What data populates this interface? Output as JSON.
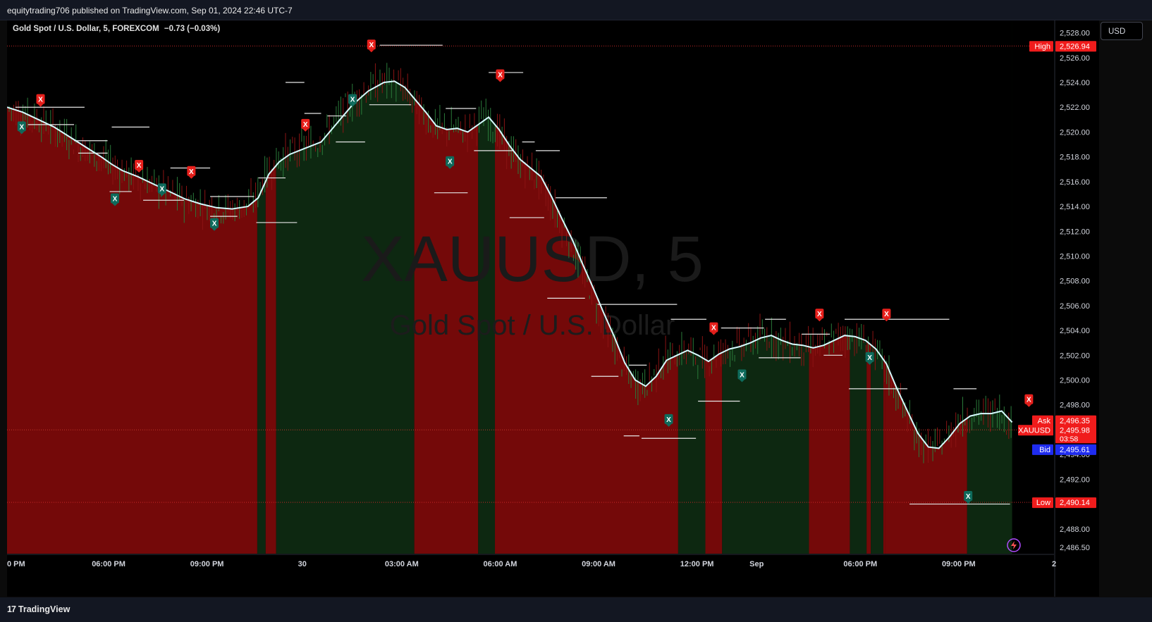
{
  "header": {
    "publish_line": "equitytrading706 published on TradingView.com, Sep 01, 2024 22:46 UTC-7"
  },
  "symbol_line": {
    "text": "Gold Spot / U.S. Dollar, 5, FOREXCOM",
    "change": "−0.73 (−0.03%)"
  },
  "currency_button": "USD",
  "footer": {
    "brand": "TradingView",
    "brand_mark": "17"
  },
  "colors": {
    "background": "#000000",
    "bear_fill": "#7a0a0a",
    "bull_fill": "#0e2a12",
    "candle_up": "#26a69a",
    "candle_down": "#ef5350",
    "ema_line": "#d6fbff",
    "x_buy_marker": "#0e6b5c",
    "x_sell_marker": "#e8201c",
    "grid": "#141414",
    "price_tag_red": "#f01c1c",
    "price_tag_blue": "#1f2cf0"
  },
  "chart_data": {
    "type": "line",
    "title": "Gold Spot / U.S. Dollar, 5, FOREXCOM",
    "watermark": {
      "symbol": "XAUUSD, 5",
      "name": "Gold Spot / U.S. Dollar"
    },
    "xlabel": "",
    "ylabel": "",
    "ylim": [
      2486.0,
      2529.0
    ],
    "y_ticks": [
      "2,528.00",
      "2,526.00",
      "2,524.00",
      "2,522.00",
      "2,520.00",
      "2,518.00",
      "2,516.00",
      "2,514.00",
      "2,512.00",
      "2,510.00",
      "2,508.00",
      "2,506.00",
      "2,504.00",
      "2,502.00",
      "2,500.00",
      "2,498.00",
      "2,496.00",
      "2,494.00",
      "2,492.00",
      "2,490.00",
      "2,488.00",
      "2,486.50"
    ],
    "x_ticks": [
      "0 PM",
      "06:00 PM",
      "09:00 PM",
      "30",
      "03:00 AM",
      "06:00 AM",
      "09:00 AM",
      "12:00 PM",
      "Sep",
      "06:00 PM",
      "09:00 PM",
      "2"
    ],
    "x_domain": [
      0,
      100
    ],
    "x_tick_positions": [
      0.0,
      9.7,
      19.1,
      28.2,
      37.7,
      47.1,
      56.5,
      65.9,
      71.6,
      81.5,
      90.9,
      100.0
    ],
    "series": [
      {
        "name": "",
        "x": [
          0,
          1.5,
          3,
          4.5,
          6,
          7.5,
          9,
          10,
          11,
          12.5,
          14,
          15.5,
          17,
          18.5,
          20,
          21.5,
          23,
          24,
          25,
          26,
          27,
          28.5,
          30,
          31,
          32,
          33,
          34.5,
          36,
          37,
          38,
          39,
          40,
          41,
          42,
          43,
          44,
          45,
          46,
          47,
          48,
          49,
          50,
          51,
          52,
          53,
          54,
          55,
          56,
          57,
          58,
          59,
          60,
          61,
          62,
          63,
          64,
          65,
          66,
          67,
          68,
          69,
          70,
          71,
          72,
          73,
          74,
          75,
          76,
          77,
          78,
          79,
          80,
          81,
          82,
          83,
          84,
          85,
          86,
          87,
          88,
          89,
          90,
          91,
          92,
          93,
          94,
          95,
          96
        ],
        "y": [
          2522.0,
          2521.6,
          2521.0,
          2520.4,
          2519.6,
          2518.8,
          2518.0,
          2517.4,
          2516.9,
          2516.4,
          2515.8,
          2515.2,
          2514.6,
          2514.2,
          2513.9,
          2513.8,
          2514.0,
          2514.7,
          2516.6,
          2517.6,
          2518.2,
          2518.7,
          2519.2,
          2520.2,
          2521.2,
          2522.2,
          2523.3,
          2524.0,
          2524.1,
          2523.6,
          2522.6,
          2521.6,
          2520.5,
          2520.2,
          2520.3,
          2520.0,
          2520.6,
          2521.2,
          2520.2,
          2518.9,
          2517.8,
          2517.1,
          2516.4,
          2514.8,
          2513.0,
          2511.3,
          2509.3,
          2507.4,
          2505.4,
          2503.5,
          2501.4,
          2500.0,
          2499.5,
          2500.3,
          2501.6,
          2502.0,
          2502.4,
          2502.0,
          2501.5,
          2502.1,
          2502.5,
          2502.7,
          2503.0,
          2503.4,
          2503.6,
          2503.2,
          2502.9,
          2502.8,
          2502.6,
          2502.8,
          2503.2,
          2503.6,
          2503.5,
          2503.2,
          2502.5,
          2501.3,
          2499.3,
          2497.5,
          2495.7,
          2494.6,
          2494.5,
          2495.4,
          2496.5,
          2497.1,
          2497.3,
          2497.3,
          2497.5,
          2496.6
        ],
        "color": "#d6fbff"
      }
    ],
    "background_zones": [
      {
        "from": 0.0,
        "to": 23.9,
        "trend": "bearish"
      },
      {
        "from": 23.9,
        "to": 24.7,
        "trend": "bullish"
      },
      {
        "from": 24.7,
        "to": 25.7,
        "trend": "bearish"
      },
      {
        "from": 25.7,
        "to": 38.9,
        "trend": "bullish"
      },
      {
        "from": 38.9,
        "to": 45.0,
        "trend": "bearish"
      },
      {
        "from": 45.0,
        "to": 46.6,
        "trend": "bullish"
      },
      {
        "from": 46.6,
        "to": 64.1,
        "trend": "bearish"
      },
      {
        "from": 64.1,
        "to": 66.7,
        "trend": "bullish"
      },
      {
        "from": 66.7,
        "to": 68.3,
        "trend": "bearish"
      },
      {
        "from": 68.3,
        "to": 76.6,
        "trend": "bullish"
      },
      {
        "from": 76.6,
        "to": 80.5,
        "trend": "bearish"
      },
      {
        "from": 80.5,
        "to": 82.1,
        "trend": "bullish"
      },
      {
        "from": 82.1,
        "to": 82.5,
        "trend": "bearish"
      },
      {
        "from": 82.5,
        "to": 83.7,
        "trend": "bullish"
      },
      {
        "from": 83.7,
        "to": 83.9,
        "trend": "bearish"
      },
      {
        "from": 83.9,
        "to": 91.7,
        "trend": "bearish"
      },
      {
        "from": 91.7,
        "to": 97.9,
        "trend": "bullish"
      }
    ],
    "markers": [
      {
        "x": 3.2,
        "y": 2522.6,
        "type": "sell",
        "label": "X"
      },
      {
        "x": 1.4,
        "y": 2520.4,
        "type": "buy",
        "label": "X"
      },
      {
        "x": 10.3,
        "y": 2514.6,
        "type": "buy",
        "label": "X"
      },
      {
        "x": 12.6,
        "y": 2517.3,
        "type": "sell",
        "label": "X"
      },
      {
        "x": 14.8,
        "y": 2515.4,
        "type": "buy",
        "label": "X"
      },
      {
        "x": 17.6,
        "y": 2516.8,
        "type": "sell",
        "label": "X"
      },
      {
        "x": 19.8,
        "y": 2512.6,
        "type": "buy",
        "label": "X"
      },
      {
        "x": 28.5,
        "y": 2520.6,
        "type": "sell",
        "label": "X"
      },
      {
        "x": 33.0,
        "y": 2522.6,
        "type": "buy",
        "label": "X"
      },
      {
        "x": 34.8,
        "y": 2527.0,
        "type": "sell",
        "label": "X"
      },
      {
        "x": 42.3,
        "y": 2517.6,
        "type": "buy",
        "label": "X"
      },
      {
        "x": 47.1,
        "y": 2524.6,
        "type": "sell",
        "label": "X"
      },
      {
        "x": 63.2,
        "y": 2496.8,
        "type": "buy",
        "label": "X"
      },
      {
        "x": 67.5,
        "y": 2504.2,
        "type": "sell",
        "label": "X"
      },
      {
        "x": 70.2,
        "y": 2500.4,
        "type": "buy",
        "label": "X"
      },
      {
        "x": 77.6,
        "y": 2505.3,
        "type": "sell",
        "label": "X"
      },
      {
        "x": 82.4,
        "y": 2501.8,
        "type": "buy",
        "label": "X"
      },
      {
        "x": 84.0,
        "y": 2505.3,
        "type": "sell",
        "label": "X"
      },
      {
        "x": 91.8,
        "y": 2490.6,
        "type": "buy",
        "label": "X"
      },
      {
        "x": 97.6,
        "y": 2498.4,
        "type": "sell",
        "label": "X"
      }
    ],
    "level_lines": [
      {
        "from": 0.8,
        "to": 7.4,
        "y": 2522.0
      },
      {
        "from": 2.0,
        "to": 6.4,
        "y": 2520.6
      },
      {
        "from": 6.4,
        "to": 9.6,
        "y": 2519.3
      },
      {
        "from": 6.8,
        "to": 9.6,
        "y": 2518.3
      },
      {
        "from": 10.0,
        "to": 13.6,
        "y": 2520.4
      },
      {
        "from": 9.8,
        "to": 11.9,
        "y": 2515.2
      },
      {
        "from": 13.0,
        "to": 16.9,
        "y": 2514.5
      },
      {
        "from": 15.6,
        "to": 19.4,
        "y": 2517.1
      },
      {
        "from": 19.4,
        "to": 23.6,
        "y": 2514.8
      },
      {
        "from": 19.4,
        "to": 22.0,
        "y": 2513.2
      },
      {
        "from": 23.8,
        "to": 27.7,
        "y": 2512.7
      },
      {
        "from": 24.0,
        "to": 26.6,
        "y": 2516.3
      },
      {
        "from": 26.6,
        "to": 28.4,
        "y": 2524.0
      },
      {
        "from": 28.4,
        "to": 30.0,
        "y": 2521.5
      },
      {
        "from": 30.6,
        "to": 32.4,
        "y": 2521.3
      },
      {
        "from": 31.4,
        "to": 34.2,
        "y": 2519.2
      },
      {
        "from": 35.6,
        "to": 41.6,
        "y": 2527.0
      },
      {
        "from": 34.6,
        "to": 38.6,
        "y": 2522.2
      },
      {
        "from": 41.9,
        "to": 44.8,
        "y": 2521.9
      },
      {
        "from": 40.8,
        "to": 44.0,
        "y": 2515.1
      },
      {
        "from": 44.6,
        "to": 48.4,
        "y": 2518.5
      },
      {
        "from": 46.0,
        "to": 49.3,
        "y": 2524.8
      },
      {
        "from": 49.2,
        "to": 50.4,
        "y": 2519.2
      },
      {
        "from": 50.5,
        "to": 52.8,
        "y": 2518.5
      },
      {
        "from": 48.0,
        "to": 51.3,
        "y": 2513.1
      },
      {
        "from": 52.4,
        "to": 57.3,
        "y": 2514.7
      },
      {
        "from": 51.6,
        "to": 55.2,
        "y": 2506.6
      },
      {
        "from": 56.4,
        "to": 64.0,
        "y": 2506.1
      },
      {
        "from": 55.8,
        "to": 58.4,
        "y": 2500.3
      },
      {
        "from": 59.4,
        "to": 61.1,
        "y": 2501.2
      },
      {
        "from": 58.9,
        "to": 60.4,
        "y": 2495.5
      },
      {
        "from": 60.6,
        "to": 65.8,
        "y": 2495.3
      },
      {
        "from": 63.4,
        "to": 66.8,
        "y": 2504.9
      },
      {
        "from": 66.0,
        "to": 70.0,
        "y": 2498.3
      },
      {
        "from": 68.2,
        "to": 72.3,
        "y": 2504.2
      },
      {
        "from": 72.4,
        "to": 74.4,
        "y": 2504.9
      },
      {
        "from": 71.8,
        "to": 75.8,
        "y": 2501.8
      },
      {
        "from": 75.9,
        "to": 78.6,
        "y": 2503.7
      },
      {
        "from": 78.0,
        "to": 79.8,
        "y": 2502.0
      },
      {
        "from": 80.0,
        "to": 90.0,
        "y": 2504.9
      },
      {
        "from": 80.4,
        "to": 86.0,
        "y": 2499.3
      },
      {
        "from": 86.2,
        "to": 95.8,
        "y": 2490.0
      },
      {
        "from": 90.4,
        "to": 92.6,
        "y": 2499.3
      }
    ],
    "price_labels": [
      {
        "label": "High",
        "value": "2,526.94",
        "y": 2526.94,
        "color": "#f01c1c"
      },
      {
        "label": "Ask",
        "value": "2,496.35",
        "y": 2496.35,
        "color": "#f01c1c"
      },
      {
        "label": "XAUUSD",
        "value": "2,495.98",
        "y": 2495.98,
        "sub": "03:58",
        "color": "#f01c1c"
      },
      {
        "label": "Bid",
        "value": "2,495.61",
        "y": 2495.61,
        "color": "#1f2cf0"
      },
      {
        "label": "Low",
        "value": "2,490.14",
        "y": 2490.14,
        "color": "#f01c1c"
      }
    ],
    "grid": false,
    "legend": "none"
  }
}
